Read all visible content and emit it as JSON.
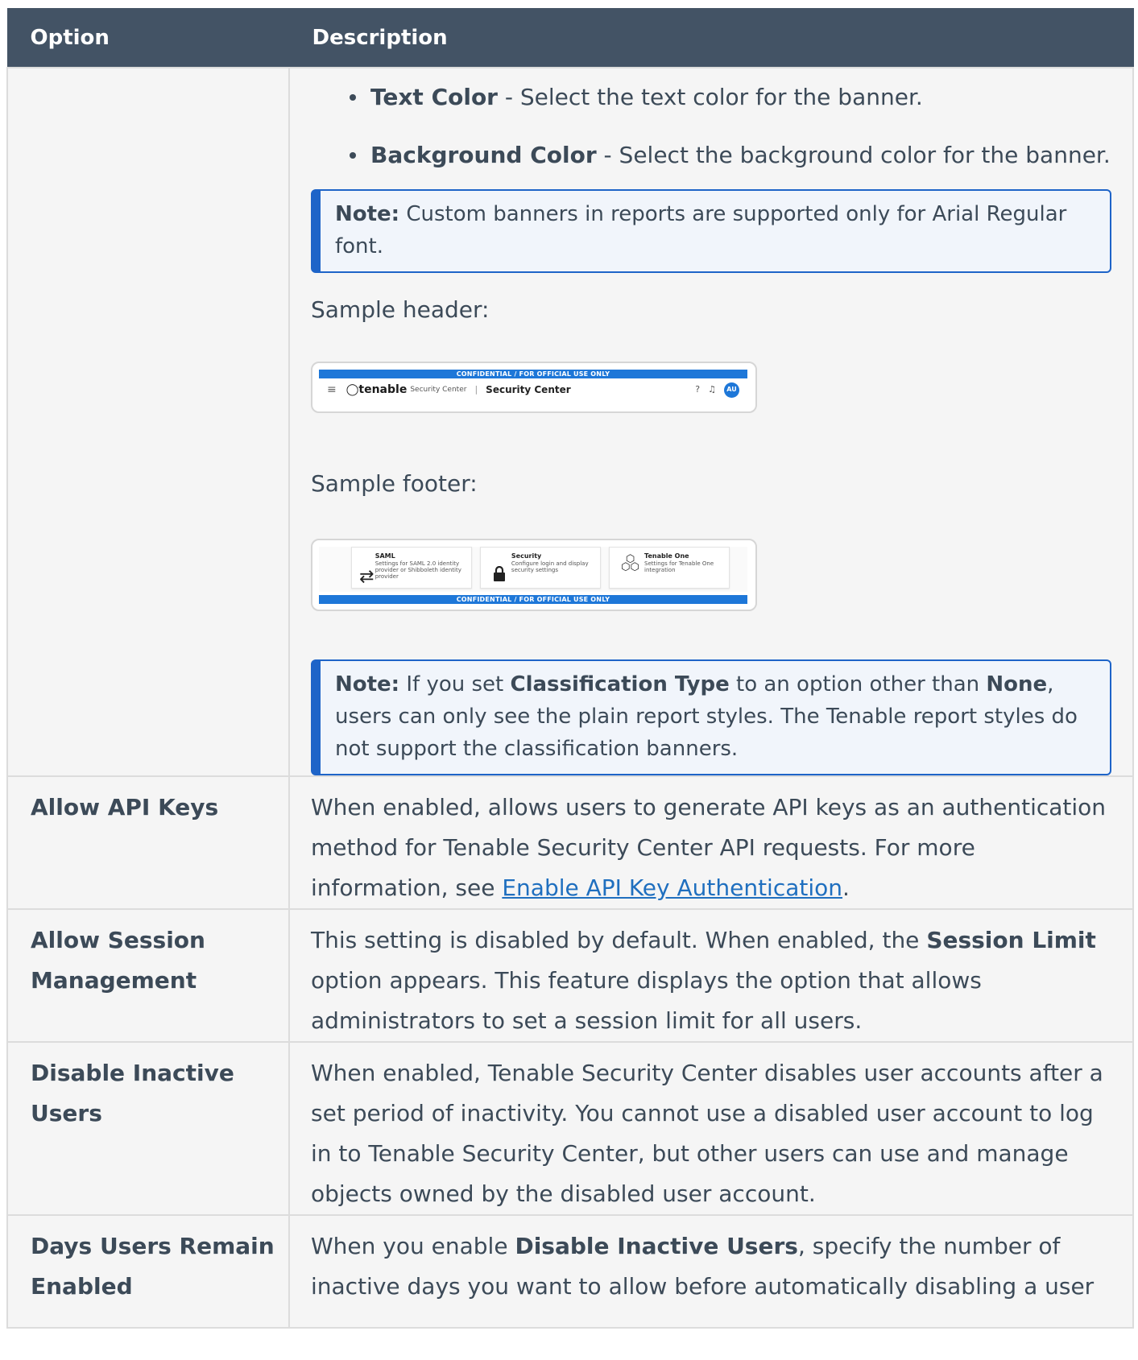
{
  "table": {
    "header_option": "Option",
    "header_description": "Description"
  },
  "first_row": {
    "bullets": [
      {
        "term": "Text Color",
        "rest": " - Select the text color for the banner."
      },
      {
        "term": "Background Color",
        "rest": " - Select the background color for the banner."
      }
    ],
    "note1": {
      "label": "Note:",
      "text": " Custom banners in reports are supported only for Arial Regular font."
    },
    "sample_header_label": "Sample header:",
    "sample_header": {
      "banner": "CONFIDENTIAL / FOR OFFICIAL USE ONLY",
      "logo": "tenable",
      "logo_sub": "Security Center",
      "title": "Security Center",
      "avatar": "AU"
    },
    "sample_footer_label": "Sample footer:",
    "sample_footer": {
      "banner": "CONFIDENTIAL / FOR OFFICIAL USE ONLY",
      "cards": [
        {
          "title": "SAML",
          "text": "Settings for SAML 2.0 identity provider or Shibboleth identity provider",
          "icon": "swap-arrows-icon"
        },
        {
          "title": "Security",
          "text": "Configure login and display security settings",
          "icon": "lock-icon"
        },
        {
          "title": "Tenable One",
          "text": "Settings for Tenable One integration",
          "icon": "hexagons-icon"
        }
      ]
    },
    "note2": {
      "label": "Note:",
      "t1": " If you set ",
      "b1": "Classification Type",
      "t2": " to an option other than ",
      "b2": "None",
      "t3": ", users can only see the plain report styles. The Tenable report styles do not support the classification banners."
    }
  },
  "rows": {
    "api_keys": {
      "option": "Allow API Keys",
      "text": "When enabled, allows users to generate API keys as an authentication method for Tenable Security Center API requests. For more information, see ",
      "link": "Enable API Key Authentication",
      "after": "."
    },
    "session": {
      "option": "Allow Session Management",
      "t1": "This setting is disabled by default. When enabled, the ",
      "b1": "Session Limit",
      "t2": " option appears. This feature displays the option that allows administrators to set a session limit for all users."
    },
    "inactive": {
      "option": "Disable Inactive Users",
      "text": "When enabled, Tenable Security Center disables user accounts after a set period of inactivity. You cannot use a disabled user account to log in to Tenable Security Center, but other users can use and manage objects owned by the disabled user account."
    },
    "days": {
      "option": "Days Users Remain Enabled",
      "t1": "When you enable ",
      "b1": "Disable Inactive Users",
      "t2": ", specify the number of inactive days you want to allow before automatically disabling a user"
    }
  }
}
